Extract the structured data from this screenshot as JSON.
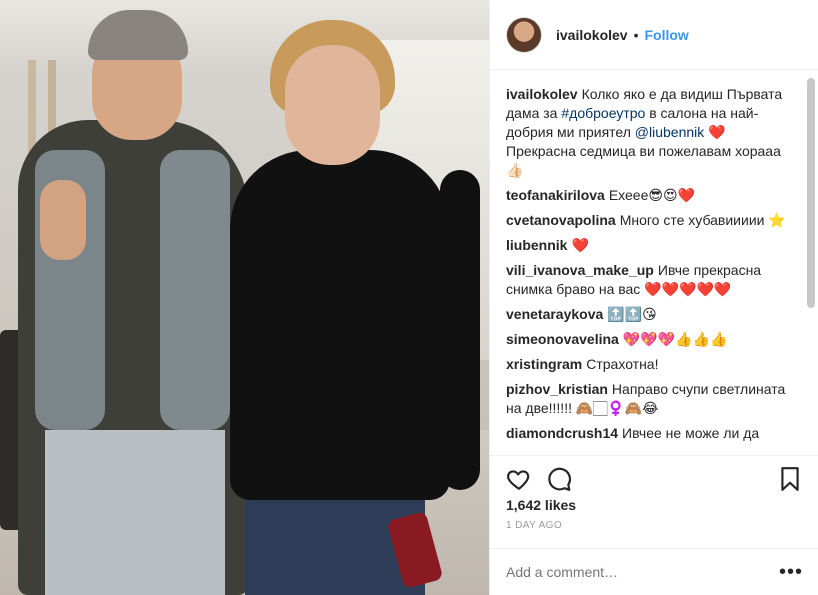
{
  "post": {
    "username": "ivailokolev",
    "separator": "•",
    "follow_label": "Follow",
    "likes": "1,642 likes",
    "time_ago": "1 DAY AGO"
  },
  "caption": {
    "user": "ivailokolev",
    "text_before": "Колко яко е да видиш Първата дама за ",
    "hashtag": "#доброеутро",
    "text_mid": " в салона на най-добрия ми приятел ",
    "mention": "@liubennik",
    "text_after": " ❤️ Прекрасна седмица ви пожелавам хорааа 👍🏻"
  },
  "comments": [
    {
      "user": "teofanakirilova",
      "text": "Ехеее😎😍❤️"
    },
    {
      "user": "cvetanovapolina",
      "text": "Много сте хубавиииии ⭐"
    },
    {
      "user": "liubennik",
      "text": "❤️"
    },
    {
      "user": "vili_ivanova_make_up",
      "text": "Ивче прекрасна снимка браво на вас ❤️❤️❤️❤️❤️"
    },
    {
      "user": "venetaraykova",
      "text": "🔝🔝😘"
    },
    {
      "user": "simeonovavelina",
      "text": "💖💖💖👍👍👍"
    },
    {
      "user": "xristingram",
      "text": "Страхотна!"
    },
    {
      "user": "pizhov_kristian",
      "text": "Направо счупи светлината на две!!!!!! 🙈🏻‍♀️🙈😂"
    },
    {
      "user": "diamondcrush14",
      "text": "Ивчее не може ли да"
    }
  ],
  "composer": {
    "placeholder": "Add a comment…",
    "more_label": "•••"
  },
  "icons": {
    "like": "heart-icon",
    "comment": "comment-bubble-icon",
    "save": "bookmark-icon",
    "more": "more-options-icon"
  },
  "colors": {
    "link": "#3897f0",
    "text": "#262626",
    "muted": "#999999",
    "tag": "#003569"
  }
}
